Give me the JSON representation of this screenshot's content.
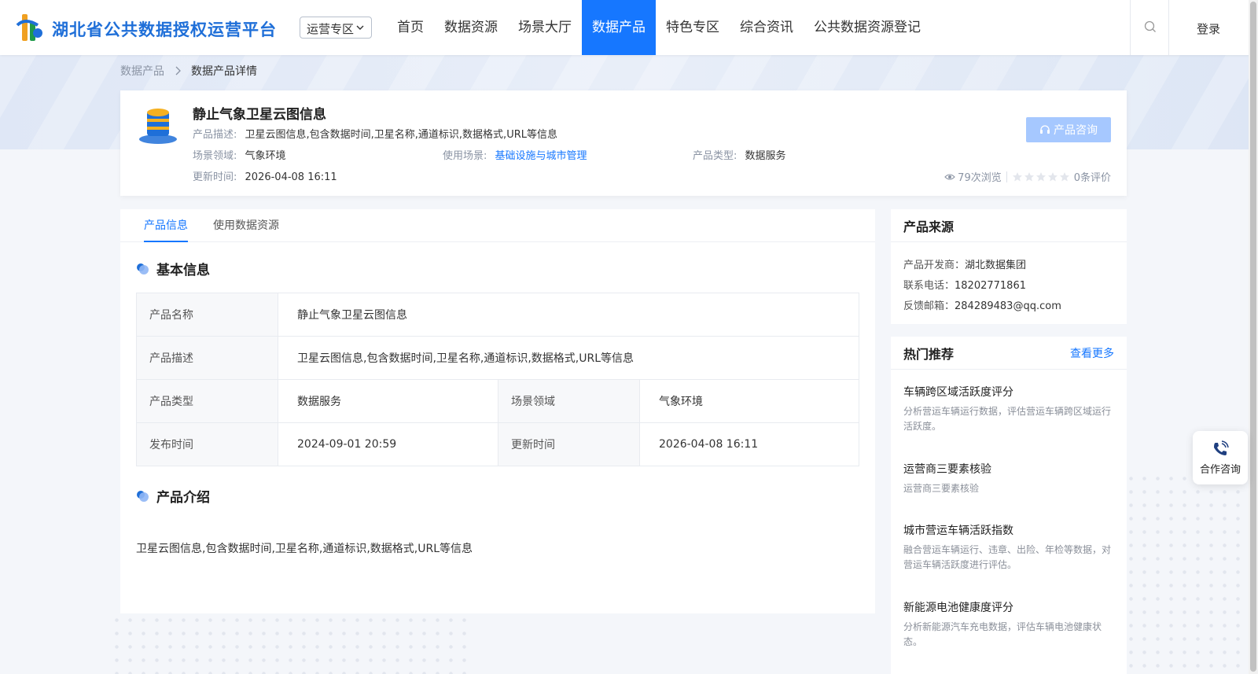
{
  "header": {
    "logo_text": "湖北省公共数据授权运营平台",
    "zone_select": "运营专区",
    "nav": [
      "首页",
      "数据资源",
      "场景大厅",
      "数据产品",
      "特色专区",
      "综合资讯",
      "公共数据资源登记"
    ],
    "active_nav": "数据产品",
    "login": "登录"
  },
  "breadcrumb": {
    "parent": "数据产品",
    "current": "数据产品详情"
  },
  "product": {
    "title": "静止气象卫星云图信息",
    "desc_label": "产品描述:",
    "desc": "卫星云图信息,包含数据时间,卫星名称,通道标识,数据格式,URL等信息",
    "domain_label": "场景领域:",
    "domain": "气象环境",
    "scenario_label": "使用场景:",
    "scenario": "基础设施与城市管理",
    "type_label": "产品类型:",
    "type": "数据服务",
    "updated_label": "更新时间:",
    "updated": "2026-04-08 16:11",
    "consult_button": "产品咨询",
    "views": "79次浏览",
    "rating_count": "0条评价",
    "rating_stars": 0
  },
  "tabs": [
    "产品信息",
    "使用数据资源"
  ],
  "active_tab": "产品信息",
  "basic_info": {
    "title": "基本信息",
    "rows": {
      "name_label": "产品名称",
      "name": "静止气象卫星云图信息",
      "desc_label": "产品描述",
      "desc": "卫星云图信息,包含数据时间,卫星名称,通道标识,数据格式,URL等信息",
      "type_label": "产品类型",
      "type": "数据服务",
      "domain_label": "场景领域",
      "domain": "气象环境",
      "published_label": "发布时间",
      "published": "2024-09-01 20:59",
      "updated_label": "更新时间",
      "updated": "2026-04-08 16:11"
    }
  },
  "intro": {
    "title": "产品介绍",
    "text": "卫星云图信息,包含数据时间,卫星名称,通道标识,数据格式,URL等信息"
  },
  "source": {
    "title": "产品来源",
    "developer_label": "产品开发商：",
    "developer": "湖北数据集团",
    "phone_label": "联系电话：",
    "phone": "18202771861",
    "email_label": "反馈邮箱：",
    "email": "284289483@qq.com"
  },
  "hot": {
    "title": "热门推荐",
    "more": "查看更多",
    "items": [
      {
        "title": "车辆跨区域活跃度评分",
        "desc": "分析营运车辆运行数据，评估营运车辆跨区域运行活跃度。"
      },
      {
        "title": "运营商三要素核验",
        "desc": "运营商三要素核验"
      },
      {
        "title": "城市营运车辆活跃指数",
        "desc": "融合营运车辆运行、违章、出险、年检等数据，对营运车辆活跃度进行评估。"
      },
      {
        "title": "新能源电池健康度评分",
        "desc": "分析新能源汽车充电数据，评估车辆电池健康状态。"
      }
    ]
  },
  "float": {
    "coop_label": "合作咨询"
  },
  "colors": {
    "primary": "#1677ff",
    "consult_disabled": "#a6c8ff"
  }
}
